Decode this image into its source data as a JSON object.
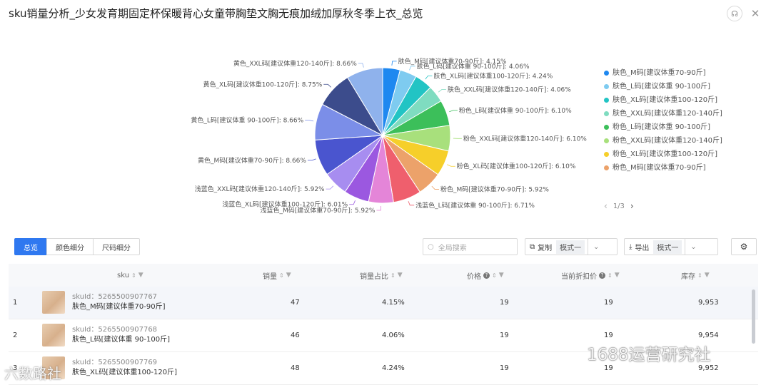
{
  "title": "sku销量分析_少女发育期固定杯保暖背心女童带胸垫文胸无痕加绒加厚秋冬季上衣_总览",
  "header_icons": [
    "headset-icon",
    "close-icon"
  ],
  "chart_data": {
    "type": "pie",
    "slices": [
      {
        "label": "肤色_M码[建议体重70-90斤]",
        "value": 4.15,
        "color": "#1e88f0"
      },
      {
        "label": "肤色_L码[建议体重 90-100斤]",
        "value": 4.06,
        "color": "#7ecbf0"
      },
      {
        "label": "肤色_XL码[建议体重100-120斤]",
        "value": 4.24,
        "color": "#22c4c4"
      },
      {
        "label": "肤色_XXL码[建议体重120-140斤]",
        "value": 4.06,
        "color": "#7fdcc0"
      },
      {
        "label": "粉色_L码[建议体重 90-100斤]",
        "value": 6.1,
        "color": "#3cbf5a"
      },
      {
        "label": "粉色_XXL码[建议体重120-140斤]",
        "value": 6.1,
        "color": "#a8e07c"
      },
      {
        "label": "粉色_XL码[建议体重100-120斤]",
        "value": 6.1,
        "color": "#f6cf2a"
      },
      {
        "label": "粉色_M码[建议体重70-90斤]",
        "value": 5.92,
        "color": "#eca26a"
      },
      {
        "label": "浅蓝色_L码[建议体重 90-100斤]",
        "value": 6.71,
        "color": "#ef5f6d"
      },
      {
        "label": "浅蓝色_M码[建议体重70-90斤]",
        "value": 5.92,
        "color": "#e485d8"
      },
      {
        "label": "浅蓝色_XL码[建议体重100-120斤]",
        "value": 6.01,
        "color": "#9b58e0"
      },
      {
        "label": "浅蓝色_XXL码[建议体重120-140斤]",
        "value": 5.92,
        "color": "#a78df0"
      },
      {
        "label": "黄色_M码[建议体重70-90斤]",
        "value": 8.66,
        "color": "#4a55cf"
      },
      {
        "label": "黄色_L码[建议体重 90-100斤]",
        "value": 8.66,
        "color": "#7b8ee8"
      },
      {
        "label": "黄色_XL码[建议体重100-120斤]",
        "value": 8.75,
        "color": "#3c4c8c"
      },
      {
        "label": "黄色_XXL码[建议体重120-140斤]",
        "value": 8.66,
        "color": "#8fb2ec"
      }
    ],
    "label_suffix": "%"
  },
  "legend": {
    "items": [
      {
        "label": "肤色_M码[建议体重70-90斤]",
        "color": "#1e88f0"
      },
      {
        "label": "肤色_L码[建议体重 90-100斤]",
        "color": "#7ecbf0"
      },
      {
        "label": "肤色_XL码[建议体重100-120斤]",
        "color": "#22c4c4"
      },
      {
        "label": "肤色_XXL码[建议体重120-140斤]",
        "color": "#7fdcc0"
      },
      {
        "label": "粉色_L码[建议体重 90-100斤]",
        "color": "#3cbf5a"
      },
      {
        "label": "粉色_XXL码[建议体重120-140斤]",
        "color": "#a8e07c"
      },
      {
        "label": "粉色_XL码[建议体重100-120斤]",
        "color": "#f6cf2a"
      },
      {
        "label": "粉色_M码[建议体重70-90斤]",
        "color": "#eca26a"
      }
    ],
    "page": "1/3",
    "prev": "‹",
    "next": "›"
  },
  "tabs": [
    {
      "label": "总览",
      "active": true
    },
    {
      "label": "颜色细分",
      "active": false
    },
    {
      "label": "尺码细分",
      "active": false
    }
  ],
  "search": {
    "placeholder": "全局搜索"
  },
  "copy": {
    "label": "复制",
    "mode": "模式一"
  },
  "export": {
    "label": "导出",
    "mode": "模式一"
  },
  "columns": {
    "sku": "sku",
    "sales": "销量",
    "share": "销量占比",
    "price": "价格",
    "discount": "当前折扣价",
    "stock": "库存"
  },
  "rows": [
    {
      "index": "1",
      "skuid": "skuId：5265500907767",
      "name": "肤色_M码[建议体重70-90斤]",
      "sales": "47",
      "share": "4.15%",
      "price": "19",
      "discount": "19",
      "stock": "9,953"
    },
    {
      "index": "2",
      "skuid": "skuId：5265500907768",
      "name": "肤色_L码[建议体重 90-100斤]",
      "sales": "46",
      "share": "4.06%",
      "price": "19",
      "discount": "19",
      "stock": "9,954"
    },
    {
      "index": "3",
      "skuid": "skuId：5265500907769",
      "name": "肤色_XL码[建议体重100-120斤]",
      "sales": "48",
      "share": "4.24%",
      "price": "19",
      "discount": "19",
      "stock": "9,952"
    }
  ],
  "watermark": {
    "right": "1688运营研究社",
    "left": "六数路社"
  }
}
